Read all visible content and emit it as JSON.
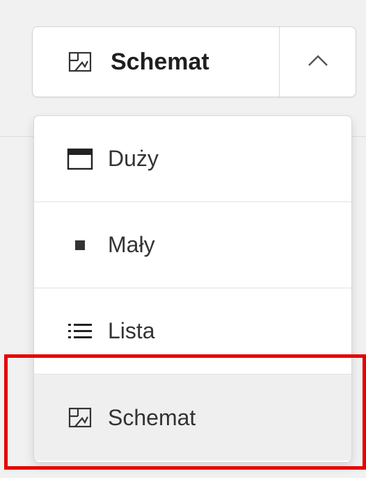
{
  "view_button": {
    "label": "Schemat",
    "icon": "image-placeholder-icon",
    "toggle_icon": "chevron-up-icon"
  },
  "menu": {
    "items": [
      {
        "label": "Duży",
        "icon": "large-window-icon",
        "selected": false
      },
      {
        "label": "Mały",
        "icon": "small-square-icon",
        "selected": false
      },
      {
        "label": "Lista",
        "icon": "list-icon",
        "selected": false
      },
      {
        "label": "Schemat",
        "icon": "image-placeholder-icon",
        "selected": true
      }
    ]
  },
  "colors": {
    "highlight": "#e60000",
    "selected_background": "#efefef"
  }
}
